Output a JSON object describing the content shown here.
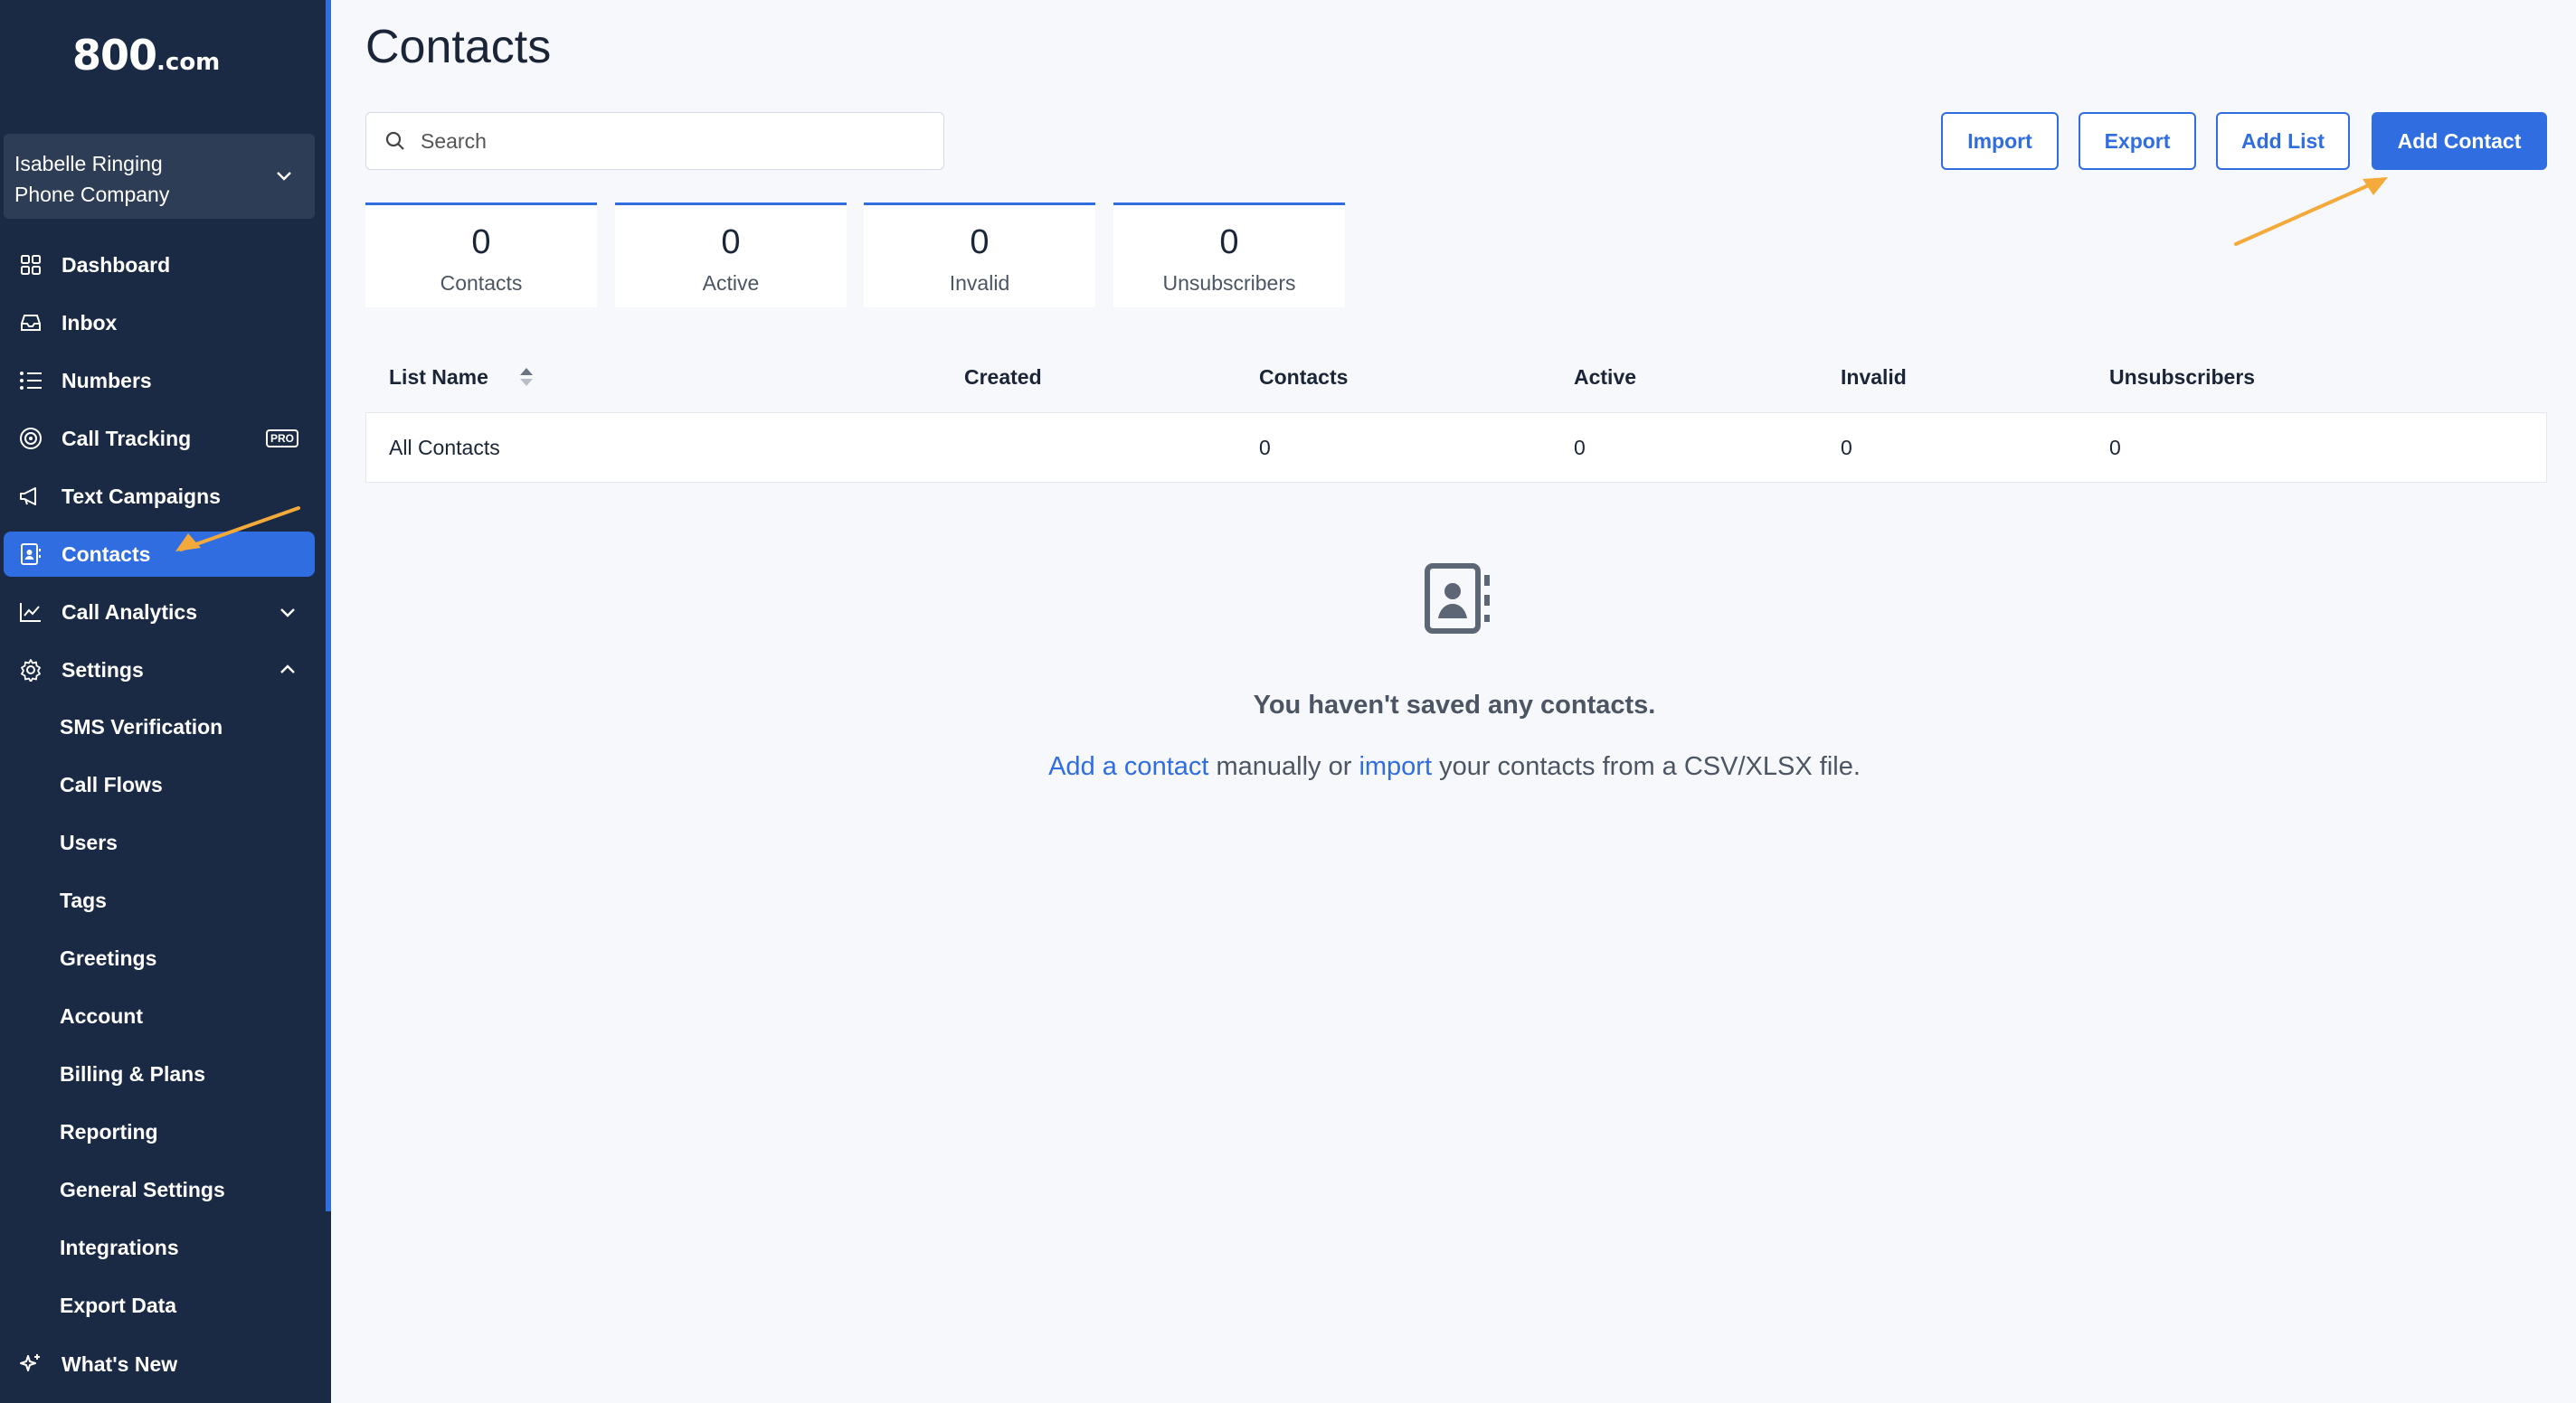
{
  "brand": {
    "logo_main": "800",
    "logo_suffix": ".com"
  },
  "account": {
    "line1": "Isabelle Ringing",
    "line2": "Phone Company"
  },
  "nav": {
    "dashboard": "Dashboard",
    "inbox": "Inbox",
    "numbers": "Numbers",
    "call_tracking": "Call Tracking",
    "pro_badge": "PRO",
    "text_campaigns": "Text Campaigns",
    "contacts": "Contacts",
    "call_analytics": "Call Analytics",
    "settings": "Settings",
    "settings_items": [
      "SMS Verification",
      "Call Flows",
      "Users",
      "Tags",
      "Greetings",
      "Account",
      "Billing & Plans",
      "Reporting",
      "General Settings",
      "Integrations",
      "Export Data"
    ],
    "whats_new": "What's New"
  },
  "page": {
    "title": "Contacts"
  },
  "search": {
    "placeholder": "Search"
  },
  "toolbar": {
    "import": "Import",
    "export": "Export",
    "add_list": "Add List",
    "add_contact": "Add Contact"
  },
  "stats": [
    {
      "value": "0",
      "label": "Contacts"
    },
    {
      "value": "0",
      "label": "Active"
    },
    {
      "value": "0",
      "label": "Invalid"
    },
    {
      "value": "0",
      "label": "Unsubscribers"
    }
  ],
  "table": {
    "headers": [
      "List Name",
      "Created",
      "Contacts",
      "Active",
      "Invalid",
      "Unsubscribers"
    ],
    "rows": [
      {
        "list_name": "All Contacts",
        "created": "",
        "contacts": "0",
        "active": "0",
        "invalid": "0",
        "unsubscribers": "0"
      }
    ]
  },
  "empty": {
    "title": "You haven't saved any contacts.",
    "link1": "Add a contact",
    "text1": " manually or ",
    "link2": "import",
    "text2": " your contacts from a CSV/XLSX file."
  },
  "colors": {
    "sidebar_bg": "#1a2a44",
    "accent": "#2f6de1",
    "annotation_arrow": "#f4a93b"
  }
}
